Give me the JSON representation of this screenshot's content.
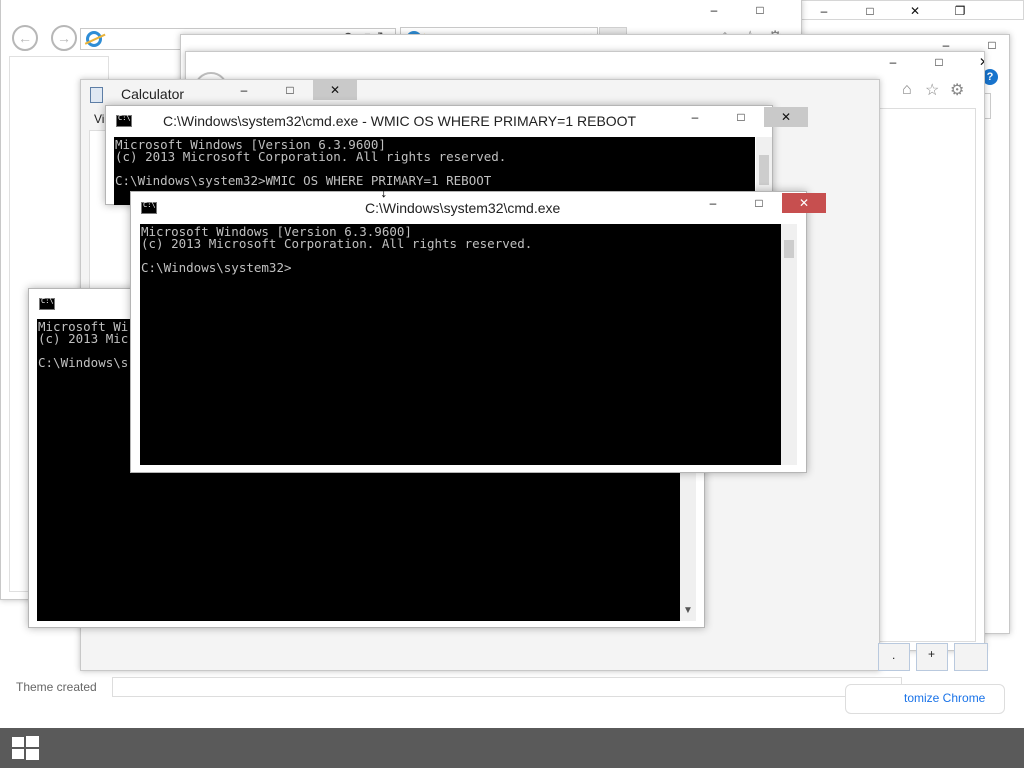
{
  "browser_back": {
    "tabs": [
      {
        "title": ""
      }
    ],
    "address": ""
  },
  "browser_mid": {
    "tabs": [
      {
        "title": ""
      }
    ],
    "address": ""
  },
  "calculator": {
    "title": "Calculator",
    "menu_first": "Vi",
    "keys": [
      ".",
      "+"
    ]
  },
  "cmd_wmic": {
    "title": "C:\\Windows\\system32\\cmd.exe - WMIC  OS WHERE PRIMARY=1 REBOOT",
    "lines": [
      "Microsoft Windows [Version 6.3.9600]",
      "(c) 2013 Microsoft Corporation. All rights reserved.",
      "",
      "C:\\Windows\\system32>WMIC OS WHERE PRIMARY=1 REBOOT"
    ]
  },
  "cmd_front": {
    "title": "C:\\Windows\\system32\\cmd.exe",
    "lines": [
      "Microsoft Windows [Version 6.3.9600]",
      "(c) 2013 Microsoft Corporation. All rights reserved.",
      "",
      "C:\\Windows\\system32>"
    ]
  },
  "cmd_back": {
    "lines": [
      "Microsoft Wi",
      "(c) 2013 Mic",
      "",
      "C:\\Windows\\s"
    ]
  },
  "bottom": {
    "theme_text": "Theme created",
    "chrome_link": "tomize Chrome",
    "help_icon": "?"
  },
  "window_controls": {
    "minimize": "–",
    "maximize": "□",
    "close": "✕",
    "restore": "❐"
  },
  "icons": {
    "back": "back-arrow-icon",
    "forward": "forward-arrow-icon",
    "ie": "internet-explorer-icon",
    "home": "home-icon",
    "favorites": "star-icon",
    "settings": "gear-icon",
    "windows": "windows-logo-icon"
  }
}
